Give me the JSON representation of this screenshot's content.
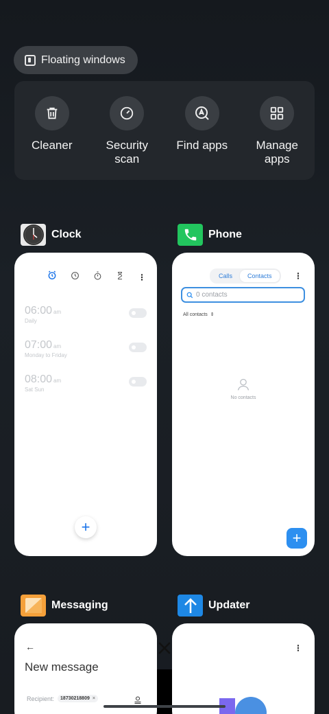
{
  "floating_windows": {
    "label": "Floating windows"
  },
  "tools": [
    {
      "label": "Cleaner",
      "icon": "trash-icon"
    },
    {
      "label": "Security\nscan",
      "icon": "security-scan-icon"
    },
    {
      "label": "Find apps",
      "icon": "find-apps-icon"
    },
    {
      "label": "Manage\napps",
      "icon": "manage-apps-icon"
    }
  ],
  "apps": {
    "clock": {
      "name": "Clock",
      "alarms": [
        {
          "time": "06:00",
          "ampm": "am",
          "repeat": "Daily",
          "enabled": false
        },
        {
          "time": "07:00",
          "ampm": "am",
          "repeat": "Monday to Friday",
          "enabled": false
        },
        {
          "time": "08:00",
          "ampm": "am",
          "repeat": "Sat Sun",
          "enabled": false
        }
      ],
      "add": "+"
    },
    "phone": {
      "name": "Phone",
      "tabs": [
        "Calls",
        "Contacts"
      ],
      "active_tab": "Contacts",
      "search_placeholder": "0 contacts",
      "filter": "All contacts",
      "empty": "No contacts",
      "add": "+"
    },
    "messaging": {
      "name": "Messaging",
      "title": "New message",
      "recipient_label": "Recipient:",
      "recipient_chip": "18730218809",
      "chip_remove": "×"
    },
    "updater": {
      "name": "Updater"
    }
  },
  "colors": {
    "accent_blue": "#2d8ff0",
    "phone_green": "#22c55e",
    "messaging_orange": "#f5a03a",
    "updater_blue": "#1e88e5"
  }
}
